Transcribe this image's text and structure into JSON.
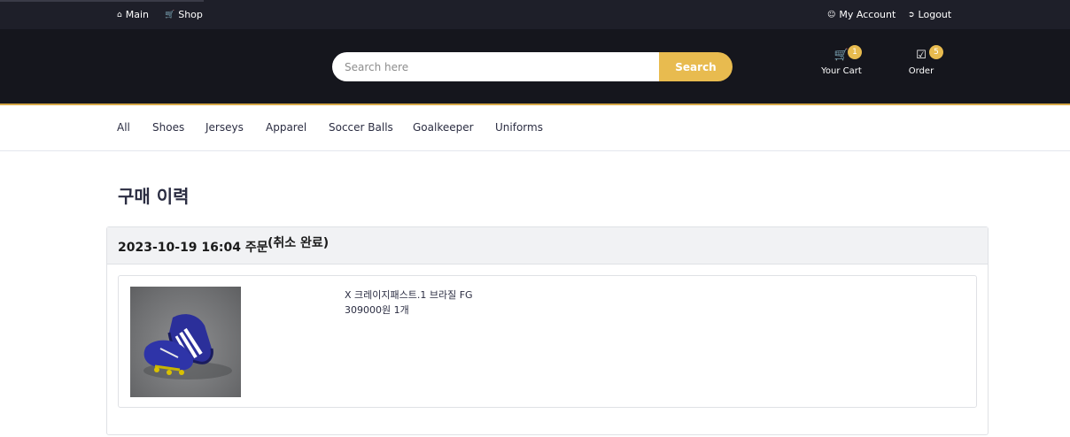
{
  "topbar": {
    "main_label": "Main",
    "shop_label": "Shop",
    "account_label": "My Account",
    "logout_label": "Logout"
  },
  "header": {
    "search_placeholder": "Search here",
    "search_button": "Search",
    "cart_label": "Your Cart",
    "cart_count": "1",
    "order_label": "Order",
    "order_count": "5"
  },
  "nav": {
    "items": [
      "All",
      "Shoes",
      "Jerseys",
      "Apparel",
      "Soccer Balls",
      "Goalkeeper",
      "Uniforms"
    ]
  },
  "page": {
    "title": "구매 이력"
  },
  "order": {
    "date": "2023-10-19 16:04 주문",
    "status": "(취소 완료)",
    "item_name": "X 크레이지패스트.1 브라질 FG",
    "item_price_qty": "309000원 1개"
  },
  "colors": {
    "accent": "#e8bb4f",
    "header_bg": "#15161d",
    "topbar_bg": "#1e1f29"
  }
}
